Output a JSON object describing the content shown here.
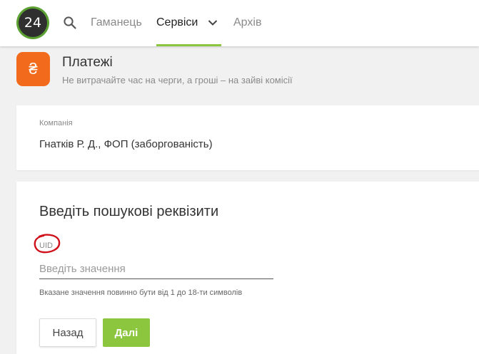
{
  "header": {
    "logo_text": "24",
    "nav": {
      "wallet": "Гаманець",
      "services": "Сервіси",
      "archive": "Архів"
    }
  },
  "page": {
    "title": "Платежі",
    "subtitle": "Не витрачайте час на черги, а гроші – на зайві комісії",
    "icon_symbol": "₴"
  },
  "company": {
    "label": "Компанія",
    "value": "Гнатків Р. Д., ФОП (заборгованість)"
  },
  "search": {
    "heading": "Введіть пошукові реквізити",
    "field_label": "UID",
    "field_value": "",
    "field_placeholder": "Введіть значення",
    "hint": "Вказане значення повинно бути від 1 до 18-ти символів"
  },
  "buttons": {
    "back": "Назад",
    "next": "Далі"
  },
  "colors": {
    "accent_green": "#8cc63f",
    "logo_green": "#5ba233",
    "payments_orange": "#f26b1d",
    "annotation_red": "#d0101a"
  },
  "icons": {
    "search": "search-icon",
    "dropdown": "chevron-down-icon",
    "payments": "hryvnia-icon"
  }
}
